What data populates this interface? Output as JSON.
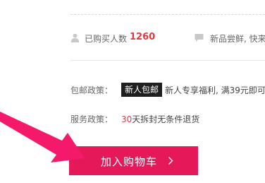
{
  "stats": {
    "buyers_label": "已购买人数",
    "buyers_count": "1260",
    "tasting_label": "新品尝鲜, 快来",
    "icons": [
      "user-icon",
      "chat-icon"
    ]
  },
  "shipping": {
    "label": "包邮政策：",
    "badge": "新人包邮",
    "text": "新人专享福利, 满39元即可"
  },
  "service": {
    "label": "服务政策：",
    "highlight": "30",
    "text": "天拆封无条件退货"
  },
  "cart_button": {
    "label": "加入购物车",
    "icon": "chevron-right-icon"
  },
  "annotation": {
    "icon": "pointer-arrow-icon",
    "color": "#f4196a"
  },
  "colors": {
    "accent": "#e5185a",
    "count": "#e4393c",
    "badge_bg": "#1f1f1f"
  }
}
